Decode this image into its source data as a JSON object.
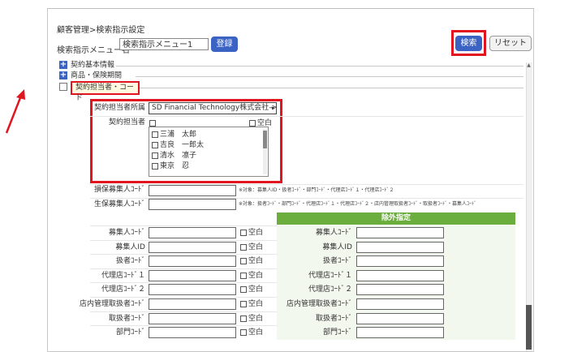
{
  "breadcrumb": "顧客管理>検索指示設定",
  "menu": {
    "label": "検索指示メニュー名",
    "value": "検索指示メニュー1",
    "register_label": "登録"
  },
  "actions": {
    "search_label": "検索",
    "reset_label": "リセット"
  },
  "tree": {
    "items": [
      {
        "icon": "+",
        "label": "契約基本情報"
      },
      {
        "icon": "+",
        "label": "商品・保険期間"
      },
      {
        "icon": "−",
        "label": "契約担当者・コード"
      }
    ]
  },
  "assignee": {
    "affiliation_label": "契約担当者所属",
    "affiliation_value": "SD Financial Technology株式会社->代理",
    "person_label": "契約担当者",
    "blank_label": "空白",
    "people": [
      "三浦　太郎",
      "吉良　一郎太",
      "清水　凛子",
      "東京　忍"
    ]
  },
  "recruiter_codes": [
    {
      "label": "損保募集人ｺｰﾄﾞ",
      "note": "※対象：募集人ID・扱者ｺｰﾄﾞ・部門ｺｰﾄﾞ・代理店ｺｰﾄﾞ１・代理店ｺｰﾄﾞ２"
    },
    {
      "label": "生保募集人ｺｰﾄﾞ",
      "note": "※対象：扱者ｺｰﾄﾞ・部門ｺｰﾄﾞ・代理店ｺｰﾄﾞ１・代理店ｺｰﾄﾞ２・店内管理取扱者ｺｰﾄﾞ・取扱者ｺｰﾄﾞ・募集人ｺｰﾄﾞ"
    }
  ],
  "exclusion_header": "除外指定",
  "code_rows": [
    {
      "label": "募集人ｺｰﾄﾞ",
      "blank": "空白",
      "excl_label": "募集人ｺｰﾄﾞ"
    },
    {
      "label": "募集人ID",
      "blank": "空白",
      "excl_label": "募集人ID"
    },
    {
      "label": "扱者ｺｰﾄﾞ",
      "blank": "空白",
      "excl_label": "扱者ｺｰﾄﾞ"
    },
    {
      "label": "代理店ｺｰﾄﾞ１",
      "blank": "空白",
      "excl_label": "代理店ｺｰﾄﾞ１"
    },
    {
      "label": "代理店ｺｰﾄﾞ２",
      "blank": "空白",
      "excl_label": "代理店ｺｰﾄﾞ２"
    },
    {
      "label": "店内管理取扱者ｺｰﾄﾞ",
      "blank": "空白",
      "excl_label": "店内管理取扱者ｺｰﾄﾞ"
    },
    {
      "label": "取扱者ｺｰﾄﾞ",
      "blank": "空白",
      "excl_label": "取扱者ｺｰﾄﾞ"
    },
    {
      "label": "部門ｺｰﾄﾞ",
      "blank": "空白",
      "excl_label": "部門ｺｰﾄﾞ"
    }
  ],
  "colors": {
    "highlight": "#e0151f",
    "button": "#3b63c4",
    "exclusion": "#6bae3e"
  }
}
